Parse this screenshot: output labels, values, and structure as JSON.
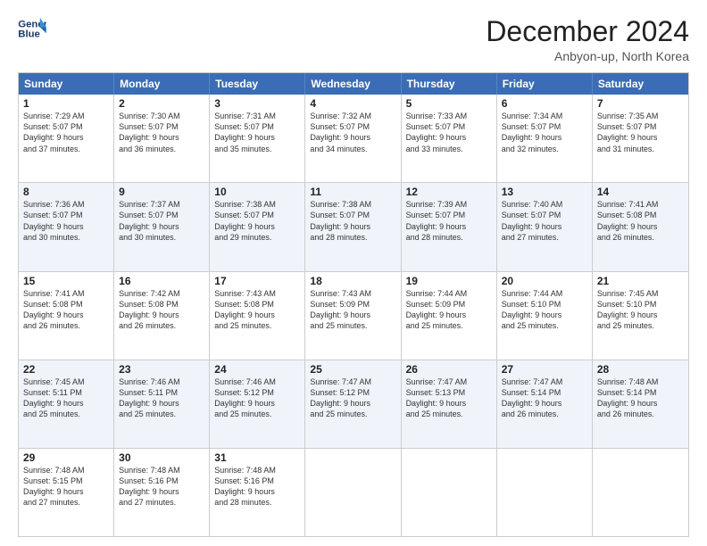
{
  "header": {
    "logo_line1": "General",
    "logo_line2": "Blue",
    "month": "December 2024",
    "location": "Anbyon-up, North Korea"
  },
  "days_of_week": [
    "Sunday",
    "Monday",
    "Tuesday",
    "Wednesday",
    "Thursday",
    "Friday",
    "Saturday"
  ],
  "weeks": [
    [
      {
        "day": "1",
        "lines": [
          "Sunrise: 7:29 AM",
          "Sunset: 5:07 PM",
          "Daylight: 9 hours",
          "and 37 minutes."
        ]
      },
      {
        "day": "2",
        "lines": [
          "Sunrise: 7:30 AM",
          "Sunset: 5:07 PM",
          "Daylight: 9 hours",
          "and 36 minutes."
        ]
      },
      {
        "day": "3",
        "lines": [
          "Sunrise: 7:31 AM",
          "Sunset: 5:07 PM",
          "Daylight: 9 hours",
          "and 35 minutes."
        ]
      },
      {
        "day": "4",
        "lines": [
          "Sunrise: 7:32 AM",
          "Sunset: 5:07 PM",
          "Daylight: 9 hours",
          "and 34 minutes."
        ]
      },
      {
        "day": "5",
        "lines": [
          "Sunrise: 7:33 AM",
          "Sunset: 5:07 PM",
          "Daylight: 9 hours",
          "and 33 minutes."
        ]
      },
      {
        "day": "6",
        "lines": [
          "Sunrise: 7:34 AM",
          "Sunset: 5:07 PM",
          "Daylight: 9 hours",
          "and 32 minutes."
        ]
      },
      {
        "day": "7",
        "lines": [
          "Sunrise: 7:35 AM",
          "Sunset: 5:07 PM",
          "Daylight: 9 hours",
          "and 31 minutes."
        ]
      }
    ],
    [
      {
        "day": "8",
        "lines": [
          "Sunrise: 7:36 AM",
          "Sunset: 5:07 PM",
          "Daylight: 9 hours",
          "and 30 minutes."
        ]
      },
      {
        "day": "9",
        "lines": [
          "Sunrise: 7:37 AM",
          "Sunset: 5:07 PM",
          "Daylight: 9 hours",
          "and 30 minutes."
        ]
      },
      {
        "day": "10",
        "lines": [
          "Sunrise: 7:38 AM",
          "Sunset: 5:07 PM",
          "Daylight: 9 hours",
          "and 29 minutes."
        ]
      },
      {
        "day": "11",
        "lines": [
          "Sunrise: 7:38 AM",
          "Sunset: 5:07 PM",
          "Daylight: 9 hours",
          "and 28 minutes."
        ]
      },
      {
        "day": "12",
        "lines": [
          "Sunrise: 7:39 AM",
          "Sunset: 5:07 PM",
          "Daylight: 9 hours",
          "and 28 minutes."
        ]
      },
      {
        "day": "13",
        "lines": [
          "Sunrise: 7:40 AM",
          "Sunset: 5:07 PM",
          "Daylight: 9 hours",
          "and 27 minutes."
        ]
      },
      {
        "day": "14",
        "lines": [
          "Sunrise: 7:41 AM",
          "Sunset: 5:08 PM",
          "Daylight: 9 hours",
          "and 26 minutes."
        ]
      }
    ],
    [
      {
        "day": "15",
        "lines": [
          "Sunrise: 7:41 AM",
          "Sunset: 5:08 PM",
          "Daylight: 9 hours",
          "and 26 minutes."
        ]
      },
      {
        "day": "16",
        "lines": [
          "Sunrise: 7:42 AM",
          "Sunset: 5:08 PM",
          "Daylight: 9 hours",
          "and 26 minutes."
        ]
      },
      {
        "day": "17",
        "lines": [
          "Sunrise: 7:43 AM",
          "Sunset: 5:08 PM",
          "Daylight: 9 hours",
          "and 25 minutes."
        ]
      },
      {
        "day": "18",
        "lines": [
          "Sunrise: 7:43 AM",
          "Sunset: 5:09 PM",
          "Daylight: 9 hours",
          "and 25 minutes."
        ]
      },
      {
        "day": "19",
        "lines": [
          "Sunrise: 7:44 AM",
          "Sunset: 5:09 PM",
          "Daylight: 9 hours",
          "and 25 minutes."
        ]
      },
      {
        "day": "20",
        "lines": [
          "Sunrise: 7:44 AM",
          "Sunset: 5:10 PM",
          "Daylight: 9 hours",
          "and 25 minutes."
        ]
      },
      {
        "day": "21",
        "lines": [
          "Sunrise: 7:45 AM",
          "Sunset: 5:10 PM",
          "Daylight: 9 hours",
          "and 25 minutes."
        ]
      }
    ],
    [
      {
        "day": "22",
        "lines": [
          "Sunrise: 7:45 AM",
          "Sunset: 5:11 PM",
          "Daylight: 9 hours",
          "and 25 minutes."
        ]
      },
      {
        "day": "23",
        "lines": [
          "Sunrise: 7:46 AM",
          "Sunset: 5:11 PM",
          "Daylight: 9 hours",
          "and 25 minutes."
        ]
      },
      {
        "day": "24",
        "lines": [
          "Sunrise: 7:46 AM",
          "Sunset: 5:12 PM",
          "Daylight: 9 hours",
          "and 25 minutes."
        ]
      },
      {
        "day": "25",
        "lines": [
          "Sunrise: 7:47 AM",
          "Sunset: 5:12 PM",
          "Daylight: 9 hours",
          "and 25 minutes."
        ]
      },
      {
        "day": "26",
        "lines": [
          "Sunrise: 7:47 AM",
          "Sunset: 5:13 PM",
          "Daylight: 9 hours",
          "and 25 minutes."
        ]
      },
      {
        "day": "27",
        "lines": [
          "Sunrise: 7:47 AM",
          "Sunset: 5:14 PM",
          "Daylight: 9 hours",
          "and 26 minutes."
        ]
      },
      {
        "day": "28",
        "lines": [
          "Sunrise: 7:48 AM",
          "Sunset: 5:14 PM",
          "Daylight: 9 hours",
          "and 26 minutes."
        ]
      }
    ],
    [
      {
        "day": "29",
        "lines": [
          "Sunrise: 7:48 AM",
          "Sunset: 5:15 PM",
          "Daylight: 9 hours",
          "and 27 minutes."
        ]
      },
      {
        "day": "30",
        "lines": [
          "Sunrise: 7:48 AM",
          "Sunset: 5:16 PM",
          "Daylight: 9 hours",
          "and 27 minutes."
        ]
      },
      {
        "day": "31",
        "lines": [
          "Sunrise: 7:48 AM",
          "Sunset: 5:16 PM",
          "Daylight: 9 hours",
          "and 28 minutes."
        ]
      },
      {
        "day": "",
        "lines": []
      },
      {
        "day": "",
        "lines": []
      },
      {
        "day": "",
        "lines": []
      },
      {
        "day": "",
        "lines": []
      }
    ]
  ]
}
